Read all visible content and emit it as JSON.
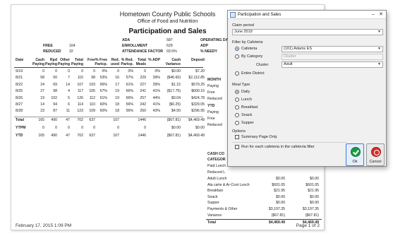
{
  "report": {
    "school_name": "Hometown County Public Schools",
    "dept": "Office of Food and Nutrition",
    "title": "Participation and Sales",
    "summary_left": [
      {
        "label": "FREE",
        "value": "164"
      },
      {
        "label": "REDUCED",
        "value": "32"
      }
    ],
    "summary_mid": [
      {
        "label": "ADA",
        "value": "587"
      },
      {
        "label": "ENROLLMENT",
        "value": "629"
      },
      {
        "label": "ATTENDANCE FACTOR",
        "value": "93.5%"
      }
    ],
    "summary_right": [
      "OPERATING DA",
      "ADP",
      "% NEEDY"
    ],
    "columns": [
      "Date",
      "Cash Paying",
      "Rpd Paying",
      "Other Paying",
      "Total Paying",
      "Free",
      "% Free Partcp.",
      "Red. used",
      "% Red. Partcp.",
      "Total Meals",
      "% ADP",
      "Cash Variance",
      "Deposit"
    ],
    "rows": [
      [
        "9/19",
        "0",
        "0",
        "0",
        "0",
        "0",
        "0%",
        "0",
        "0%",
        "0",
        "0%",
        "$0.00",
        "$7.20"
      ],
      [
        "8/21",
        "58",
        "50",
        "7",
        "115",
        "98",
        "53%",
        "16",
        "57%",
        "229",
        "39%",
        "($46.60)",
        "$2,112.85"
      ],
      [
        "8/22",
        "24",
        "69",
        "14",
        "107",
        "103",
        "56%",
        "17",
        "61%",
        "227",
        "39%",
        "$1.15",
        "$579.25"
      ],
      [
        "8/25",
        "27",
        "98",
        "4",
        "117",
        "105",
        "57%",
        "19",
        "66%",
        "241",
        "41%",
        "($17.75)",
        "$600.15"
      ],
      [
        "8/26",
        "19",
        "102",
        "5",
        "126",
        "112",
        "61%",
        "19",
        "66%",
        "257",
        "44%",
        "$0.04",
        "$424.78"
      ],
      [
        "8/27",
        "14",
        "94",
        "6",
        "114",
        "110",
        "60%",
        "18",
        "56%",
        "242",
        "41%",
        "($0.25)",
        "$329.05"
      ],
      [
        "8/28",
        "23",
        "87",
        "11",
        "123",
        "109",
        "60%",
        "18",
        "56%",
        "250",
        "43%",
        "$4.50",
        "$296.95"
      ]
    ],
    "totals": [
      {
        "label": "Total",
        "values": [
          "165",
          "490",
          "47",
          "702",
          "637",
          "",
          "107",
          "",
          "1446",
          "",
          "($67.81)",
          "$4,469.49"
        ]
      },
      {
        "label": "YTPM",
        "values": [
          "0",
          "0",
          "0",
          "0",
          "0",
          "",
          "0",
          "",
          "0",
          "",
          "$0.00",
          "$0.00"
        ]
      },
      {
        "label": "YTD",
        "values": [
          "165",
          "490",
          "47",
          "702",
          "637",
          "",
          "107",
          "",
          "1446",
          "",
          "($67.81)",
          "$4,469.49"
        ]
      }
    ],
    "month_section": {
      "header": "MONTH",
      "items": [
        "Paying",
        "Free",
        "Reduced"
      ],
      "ytd_header": "YTD",
      "ytd_items": [
        "Paying",
        "Free",
        "Reduced"
      ]
    },
    "cash_section": {
      "title_line1": "CASH CO",
      "title_line2": "CATEGOR",
      "partial_rows": [
        "Paid Lunch",
        "Reduced L"
      ],
      "rows": [
        [
          "Adult Lunch",
          "$0.00",
          "$0.00"
        ],
        [
          "Ala carte & Ar-Cost Lunch",
          "$601.05",
          "$601.05"
        ],
        [
          "Breakfast",
          "$21.95",
          "$21.95"
        ],
        [
          "Snack",
          "$0.00",
          "$0.00"
        ],
        [
          "Supper",
          "$0.00",
          "$0.00"
        ],
        [
          "Payments & Other",
          "$3,197.35",
          "$3,197.35"
        ],
        [
          "Variance",
          "($67.81)",
          "($67.81)"
        ]
      ],
      "total": [
        "Total",
        "$4,469.49",
        "$4,469.49"
      ]
    },
    "footer_date": "February 17, 2015 1:09 PM",
    "footer_page": "Page 1 of 2"
  },
  "dialog": {
    "title": "Participation and Sales",
    "claim_period_label": "Claim period",
    "claim_period_value": "June 2019",
    "filter_label": "Filter by Cafeteria",
    "cafeteria_option": "Cafeteria",
    "cafeteria_value": "(101) Adams ES",
    "by_category_option": "By Category",
    "category_value": "Cluster",
    "cluster_label": "Cluster",
    "cluster_value": "Adult",
    "entire_district_option": "Entire District",
    "meal_type_label": "Meal Type",
    "meal_types": [
      "Daily",
      "Lunch",
      "Breakfast",
      "Snack",
      "Supper"
    ],
    "options_label": "Options",
    "summary_only": "Summary Page Only",
    "run_each": "Run for each cafeteria in the cafeteria filter",
    "ok_label": "Ok",
    "cancel_label": "Cancel"
  }
}
